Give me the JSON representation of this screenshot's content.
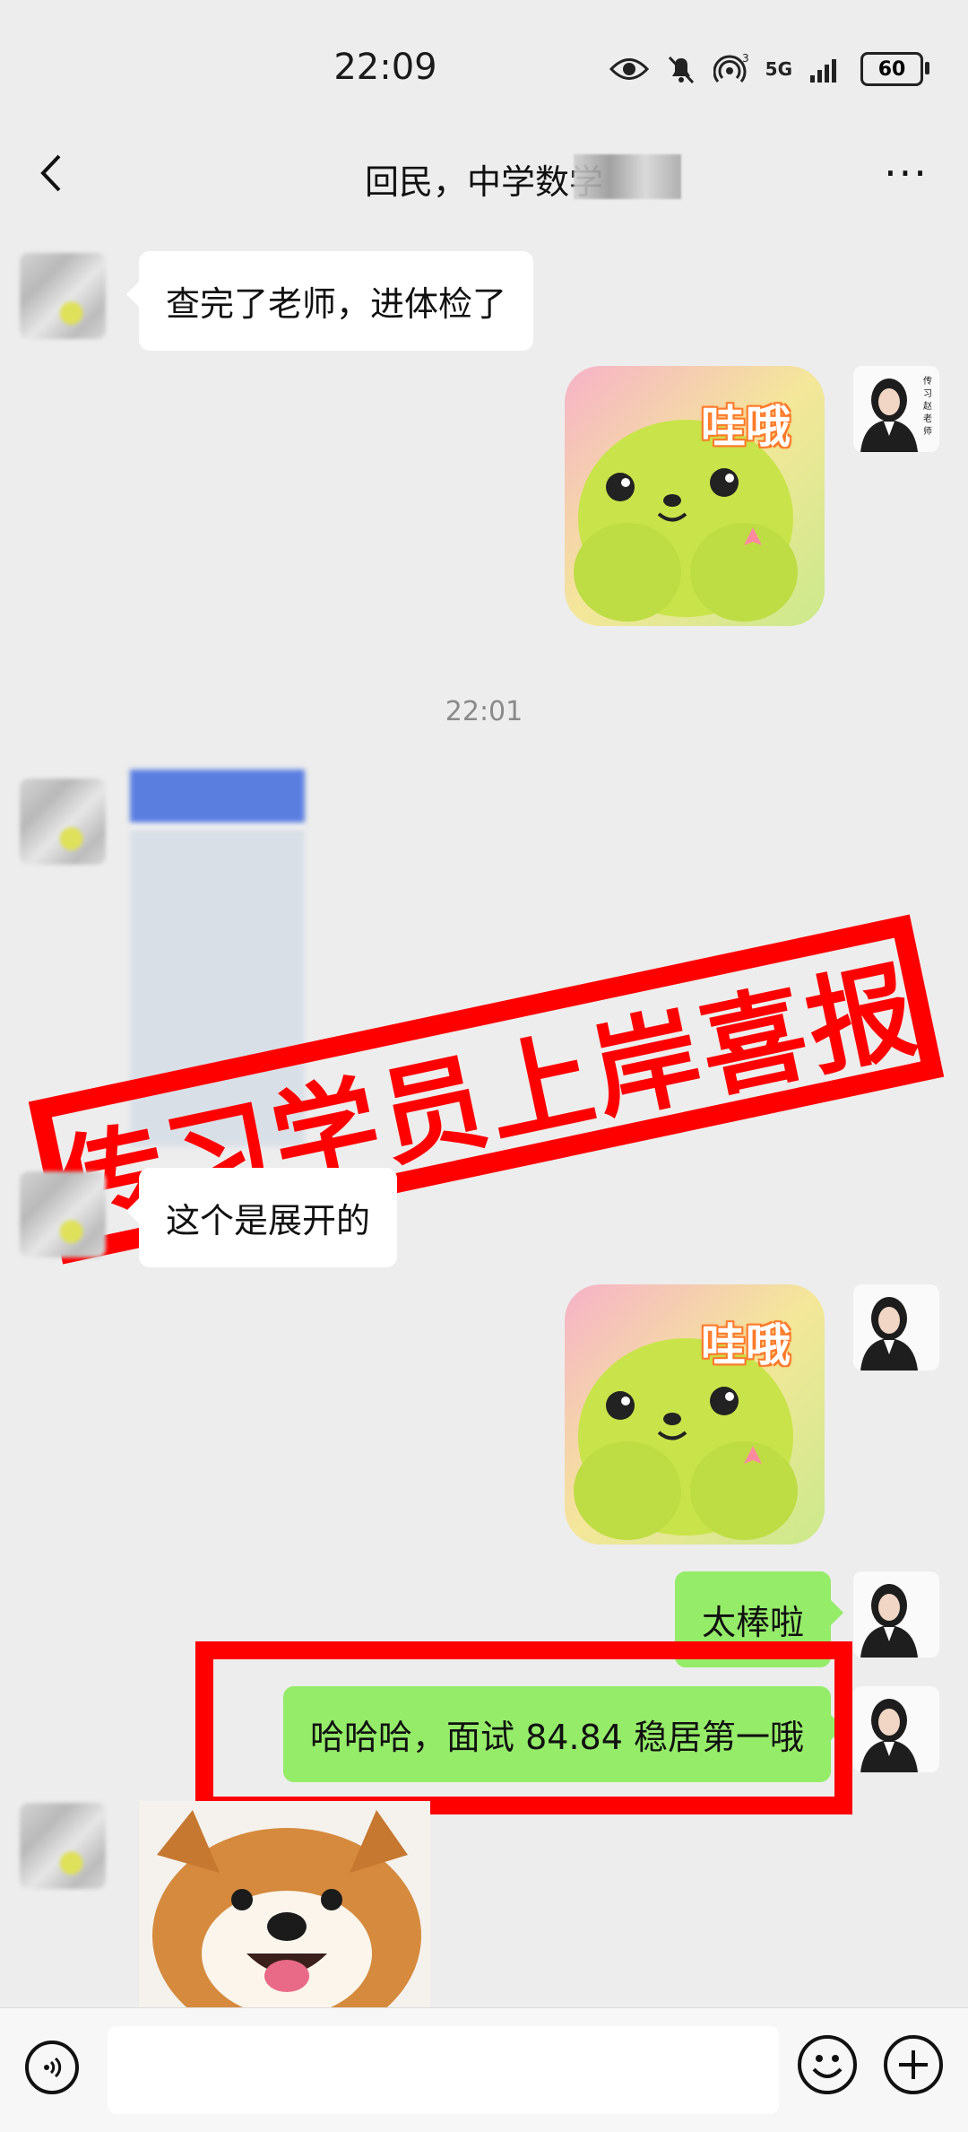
{
  "status_bar": {
    "time": "22:09",
    "battery": "60",
    "network": "5G"
  },
  "header": {
    "back_icon": "chevron-left-icon",
    "title": "回民，中学数学",
    "more_label": "···"
  },
  "messages": [
    {
      "side": "in",
      "text": "查完了老师，进体检了"
    },
    {
      "side": "out",
      "type": "sticker",
      "sticker_text": "哇哦"
    },
    {
      "type": "timestamp",
      "text": "22:01"
    },
    {
      "side": "in",
      "type": "image",
      "blurred": true
    },
    {
      "side": "in",
      "text": "这个是展开的"
    },
    {
      "side": "out",
      "type": "sticker",
      "sticker_text": "哇哦"
    },
    {
      "side": "out",
      "text": "太棒啦"
    },
    {
      "side": "out",
      "text": "哈哈哈，面试 84.84 稳居第一哦",
      "highlighted": true
    },
    {
      "side": "in",
      "type": "image",
      "description_icon": "dog-photo"
    }
  ],
  "stamp": {
    "text": "传习学员上岸喜报",
    "color": "#ff0000"
  },
  "avatar_me": {
    "caption": "传习赵老师"
  },
  "bottom_bar": {
    "input_placeholder": "",
    "voice_icon": "voice-icon",
    "emoji_icon": "emoji-icon",
    "plus_icon": "plus-icon"
  },
  "colors": {
    "outgoing_bubble": "#95ec69",
    "incoming_bubble": "#ffffff",
    "background": "#ededed"
  }
}
